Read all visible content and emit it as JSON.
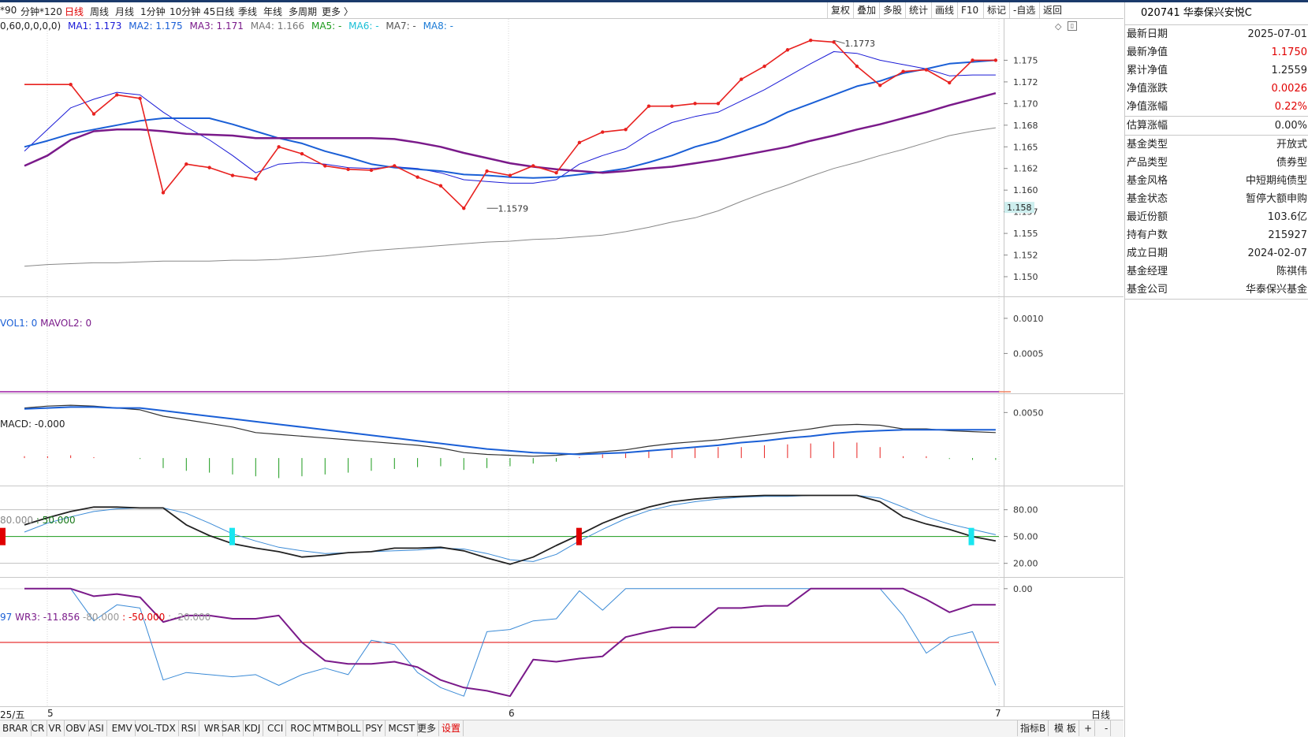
{
  "toolbar": {
    "periods": [
      "*90",
      "分钟*120",
      "日线",
      "周线",
      "月线",
      "1分钟",
      "10分钟",
      "45日线",
      "季线",
      "年线",
      "多周期",
      "更多 〉"
    ],
    "active_period": "日线",
    "buttons": [
      "复权",
      "叠加",
      "多股",
      "统计",
      "画线",
      "F10",
      "标记",
      "-自选",
      "返回"
    ]
  },
  "ma_legend": {
    "params": "0,60,0,0,0,0)",
    "items": [
      {
        "label": "MA1: 1.173",
        "color": "#1a1ad6"
      },
      {
        "label": "MA2: 1.175",
        "color": "#1a5fd6"
      },
      {
        "label": "MA3: 1.171",
        "color": "#7a1a8a"
      },
      {
        "label": "MA4: 1.166",
        "color": "#777777"
      },
      {
        "label": "MA5: -",
        "color": "#1a9a1a"
      },
      {
        "label": "MA6: -",
        "color": "#19bfd6"
      },
      {
        "label": "MA7: -",
        "color": "#555555"
      },
      {
        "label": "MA8: -",
        "color": "#1a7ad6"
      }
    ]
  },
  "vol_legend": {
    "vol": "VOL1: 0",
    "mavol": "MAVOL2: 0"
  },
  "macd_legend": "MACD: -0.000",
  "kdj_legend": {
    "a": "80.000",
    "b": ": 50.000"
  },
  "wr_legend": {
    "prefix": "97",
    "wr3": "WR3: -11.856",
    "l1": "-80.000",
    "l2": ": -50.000",
    "l3": ": -20.000"
  },
  "date_axis": {
    "start": "25/五",
    "ticks": [
      "5",
      "6",
      "7"
    ],
    "period": "日线"
  },
  "sidebar": {
    "title": "020741 华泰保兴安悦C",
    "rows1": [
      {
        "k": "最新日期",
        "v": "2025-07-01",
        "red": false
      },
      {
        "k": "最新净值",
        "v": "1.1750",
        "red": true
      },
      {
        "k": "累计净值",
        "v": "1.2559",
        "red": false
      },
      {
        "k": "净值涨跌",
        "v": "0.0026",
        "red": true
      },
      {
        "k": "净值涨幅",
        "v": "0.22%",
        "red": true
      }
    ],
    "rows2": [
      {
        "k": "估算涨幅",
        "v": "0.00%",
        "red": false
      }
    ],
    "rows3": [
      {
        "k": "基金类型",
        "v": "开放式",
        "red": false
      },
      {
        "k": "产品类型",
        "v": "债券型",
        "red": false
      },
      {
        "k": "基金风格",
        "v": "中短期纯债型",
        "red": false
      },
      {
        "k": "基金状态",
        "v": "暂停大额申购",
        "red": false
      },
      {
        "k": "最近份额",
        "v": "103.6亿",
        "red": false
      },
      {
        "k": "持有户数",
        "v": "215927",
        "red": false
      },
      {
        "k": "成立日期",
        "v": "2024-02-07",
        "red": false
      },
      {
        "k": "基金经理",
        "v": "陈祺伟",
        "red": false
      },
      {
        "k": "基金公司",
        "v": "华泰保兴基金",
        "red": false
      }
    ]
  },
  "bottom_tabs": [
    "BRAR",
    "CR",
    "VR",
    "OBV",
    "ASI",
    "EMV",
    "VOL-TDX",
    "RSI",
    "WR",
    "SAR",
    "KDJ",
    "CCI",
    "ROC",
    "MTM",
    "BOLL",
    "PSY",
    "MCST",
    "更多",
    "设置"
  ],
  "bottom_highlight": "设置",
  "bottom_right": [
    "指标B",
    "模 板",
    "+",
    "-"
  ],
  "chart_data": {
    "type": "line",
    "ylim": [
      1.149,
      1.1785
    ],
    "y_ticks": [
      "1.175",
      "1.172",
      "1.170",
      "1.168",
      "1.165",
      "1.162",
      "1.160",
      "1.157",
      "1.155",
      "1.152",
      "1.150"
    ],
    "y_tick_values": [
      1.175,
      1.1725,
      1.17,
      1.1675,
      1.165,
      1.1625,
      1.16,
      1.1575,
      1.155,
      1.1525,
      1.15
    ],
    "current_value": "1.158",
    "current_value_num": 1.158,
    "annotations": [
      {
        "label": "1.1773",
        "x": 33,
        "y": 1.1773
      },
      {
        "label": "1.1579",
        "x": 18,
        "y": 1.1579
      }
    ],
    "x": [
      -2,
      -1,
      0,
      1,
      2,
      3,
      4,
      5,
      6,
      7,
      8,
      9,
      10,
      11,
      12,
      13,
      14,
      15,
      16,
      17,
      18,
      19,
      20,
      21,
      22,
      23,
      24,
      25,
      26,
      27,
      28,
      29,
      30,
      31,
      32,
      33,
      34,
      35,
      36,
      37,
      38,
      39,
      40
    ],
    "series": [
      {
        "name": "MA1",
        "color": "#e8211f",
        "marker": true,
        "width": 1.6,
        "values": [
          1.1722,
          1.1722,
          1.1722,
          1.1688,
          1.171,
          1.1706,
          1.1597,
          1.163,
          1.1626,
          1.1617,
          1.1613,
          1.165,
          1.1642,
          1.1628,
          1.1624,
          1.1623,
          1.1628,
          1.1615,
          1.1605,
          1.1579,
          1.1622,
          1.1617,
          1.1628,
          1.162,
          1.1655,
          1.1667,
          1.167,
          1.1697,
          1.1697,
          1.17,
          1.17,
          1.1728,
          1.1743,
          1.1762,
          1.1773,
          1.1771,
          1.1743,
          1.1721,
          1.1737,
          1.1739,
          1.1724,
          1.175,
          1.175
        ]
      },
      {
        "name": "MA2",
        "color": "#1a1ad6",
        "marker": false,
        "width": 1,
        "values": [
          1.1645,
          1.167,
          1.1695,
          1.1705,
          1.1713,
          1.171,
          1.169,
          1.1673,
          1.1658,
          1.164,
          1.162,
          1.163,
          1.1632,
          1.163,
          1.1626,
          1.1625,
          1.1627,
          1.1625,
          1.162,
          1.1612,
          1.161,
          1.1608,
          1.1608,
          1.1612,
          1.163,
          1.164,
          1.1648,
          1.1665,
          1.1678,
          1.1685,
          1.169,
          1.1703,
          1.1716,
          1.1731,
          1.1746,
          1.176,
          1.1758,
          1.175,
          1.1745,
          1.174,
          1.1732,
          1.1733,
          1.1733
        ]
      },
      {
        "name": "MA3",
        "color": "#1a5fd6",
        "marker": false,
        "width": 2,
        "values": [
          1.165,
          1.1657,
          1.1665,
          1.167,
          1.1675,
          1.168,
          1.1683,
          1.1683,
          1.1683,
          1.1676,
          1.1668,
          1.166,
          1.1654,
          1.1645,
          1.1638,
          1.163,
          1.1626,
          1.1624,
          1.1622,
          1.1618,
          1.1617,
          1.1615,
          1.1614,
          1.1615,
          1.1618,
          1.1621,
          1.1625,
          1.1632,
          1.164,
          1.165,
          1.1657,
          1.1667,
          1.1677,
          1.169,
          1.17,
          1.171,
          1.172,
          1.1726,
          1.1735,
          1.174,
          1.1746,
          1.1748,
          1.175
        ]
      },
      {
        "name": "MA4",
        "color": "#7a1a8a",
        "marker": false,
        "width": 2.5,
        "values": [
          1.1628,
          1.164,
          1.1658,
          1.1668,
          1.167,
          1.167,
          1.1668,
          1.1665,
          1.1664,
          1.1663,
          1.166,
          1.166,
          1.166,
          1.166,
          1.166,
          1.166,
          1.1659,
          1.1655,
          1.165,
          1.1643,
          1.1637,
          1.1631,
          1.1627,
          1.1624,
          1.1622,
          1.162,
          1.1622,
          1.1625,
          1.1627,
          1.1631,
          1.1635,
          1.164,
          1.1645,
          1.165,
          1.1657,
          1.1663,
          1.167,
          1.1676,
          1.1683,
          1.169,
          1.1698,
          1.1705,
          1.1712
        ]
      },
      {
        "name": "MA5",
        "color": "#888888",
        "marker": false,
        "width": 1,
        "values": [
          1.1512,
          1.1514,
          1.1515,
          1.1516,
          1.1516,
          1.1517,
          1.1518,
          1.1518,
          1.1518,
          1.1519,
          1.1519,
          1.152,
          1.1522,
          1.1524,
          1.1527,
          1.153,
          1.1532,
          1.1534,
          1.1536,
          1.1538,
          1.154,
          1.1541,
          1.1543,
          1.1544,
          1.1546,
          1.1548,
          1.1552,
          1.1557,
          1.1563,
          1.1568,
          1.1576,
          1.1587,
          1.1597,
          1.1606,
          1.1616,
          1.1625,
          1.1632,
          1.164,
          1.1647,
          1.1655,
          1.1663,
          1.1668,
          1.1672
        ]
      }
    ],
    "volume": {
      "ylim": [
        0,
        0.0012
      ],
      "y_ticks": [
        "0.0010",
        "0.0005"
      ],
      "y_tick_values": [
        0.001,
        0.0005
      ],
      "values": [
        0,
        0,
        0,
        0,
        0,
        0,
        0,
        0,
        0,
        0,
        0,
        0,
        0,
        0,
        0,
        0,
        0,
        0,
        0,
        0,
        0,
        0,
        0,
        0,
        0,
        0,
        0,
        0,
        0,
        0,
        0,
        0,
        0,
        0,
        0,
        0,
        0,
        0,
        0,
        0,
        0,
        0,
        0
      ]
    },
    "macd": {
      "ylim": [
        -0.0025,
        0.0065
      ],
      "y_ticks": [
        "0.0050"
      ],
      "y_tick_values": [
        0.005
      ],
      "dif": [
        0.0055,
        0.0057,
        0.0058,
        0.0057,
        0.0055,
        0.0053,
        0.0046,
        0.0042,
        0.0038,
        0.0034,
        0.0028,
        0.0026,
        0.0024,
        0.0022,
        0.002,
        0.0018,
        0.0016,
        0.0014,
        0.0011,
        0.0006,
        0.0004,
        0.0003,
        0.0002,
        0.0003,
        0.0005,
        0.0007,
        0.0009,
        0.0013,
        0.0016,
        0.0018,
        0.002,
        0.0023,
        0.0026,
        0.0029,
        0.0032,
        0.0036,
        0.0037,
        0.0036,
        0.0032,
        0.0032,
        0.003,
        0.0029,
        0.0028
      ],
      "dea": [
        0.0054,
        0.0055,
        0.0056,
        0.0056,
        0.0055,
        0.0055,
        0.0052,
        0.0049,
        0.0046,
        0.0043,
        0.004,
        0.0037,
        0.0034,
        0.0031,
        0.0028,
        0.0025,
        0.0022,
        0.0019,
        0.0016,
        0.0013,
        0.001,
        0.0008,
        0.0006,
        0.0005,
        0.0004,
        0.0005,
        0.0006,
        0.0008,
        0.001,
        0.0012,
        0.0014,
        0.0017,
        0.0019,
        0.0022,
        0.0024,
        0.0027,
        0.0029,
        0.003,
        0.0031,
        0.0031,
        0.0031,
        0.0031,
        0.0031
      ],
      "hist": [
        0.0002,
        0.0002,
        0.0003,
        0.0001,
        0.0,
        -0.0001,
        -0.0011,
        -0.0014,
        -0.0016,
        -0.0018,
        -0.002,
        -0.0022,
        -0.002,
        -0.0018,
        -0.0016,
        -0.0014,
        -0.0012,
        -0.001,
        -0.0009,
        -0.0013,
        -0.0011,
        -0.0009,
        -0.0006,
        -0.0004,
        0.0001,
        0.0004,
        0.0005,
        0.0008,
        0.001,
        0.0011,
        0.0012,
        0.0012,
        0.0014,
        0.0015,
        0.0016,
        0.0018,
        0.0017,
        0.0012,
        0.0002,
        0.0002,
        -0.0001,
        -0.0002,
        -0.0002
      ]
    },
    "kdj": {
      "ylim": [
        10,
        100
      ],
      "y_ticks": [
        "80.00",
        "50.00",
        "20.00"
      ],
      "y_tick_values": [
        80,
        50,
        20
      ],
      "k": [
        63,
        71,
        78,
        83,
        83,
        82,
        82,
        63,
        51,
        42,
        37,
        33,
        27,
        29,
        32,
        33,
        37,
        37,
        38,
        34,
        26,
        19,
        27,
        40,
        52,
        65,
        75,
        83,
        89,
        92,
        94,
        95,
        96,
        96,
        96,
        96,
        96,
        89,
        72,
        64,
        58,
        50,
        45
      ],
      "d": [
        55,
        65,
        72,
        78,
        81,
        82,
        82,
        76,
        65,
        53,
        45,
        38,
        34,
        31,
        32,
        33,
        34,
        35,
        37,
        36,
        31,
        24,
        22,
        30,
        45,
        58,
        70,
        79,
        85,
        89,
        92,
        94,
        95,
        95,
        96,
        96,
        96,
        93,
        83,
        72,
        64,
        58,
        52
      ]
    },
    "wr": {
      "ylim": [
        -105,
        5
      ],
      "y_ticks": [
        "0.00"
      ],
      "y_tick_values": [
        0
      ],
      "wr1": [
        0,
        0,
        0,
        -30,
        -15,
        -18,
        -85,
        -78,
        -80,
        -82,
        -80,
        -90,
        -80,
        -74,
        -80,
        -48,
        -52,
        -78,
        -92,
        -100,
        -40,
        -38,
        -30,
        -28,
        -2,
        -20,
        0,
        0,
        0,
        0,
        0,
        0,
        0,
        0,
        0,
        0,
        0,
        0,
        -25,
        -60,
        -45,
        -40,
        -90,
        -45
      ],
      "wr3": [
        0,
        0,
        0,
        -7,
        -5,
        -8,
        -31,
        -25,
        -25,
        -28,
        -28,
        -25,
        -50,
        -67,
        -70,
        -70,
        -68,
        -73,
        -85,
        -92,
        -95,
        -100,
        -66,
        -68,
        -65,
        -63,
        -45,
        -40,
        -36,
        -36,
        -18,
        -18,
        -16,
        -16,
        0,
        0,
        0,
        0,
        0,
        -10,
        -22,
        -15,
        -15,
        -23,
        -12
      ]
    }
  }
}
